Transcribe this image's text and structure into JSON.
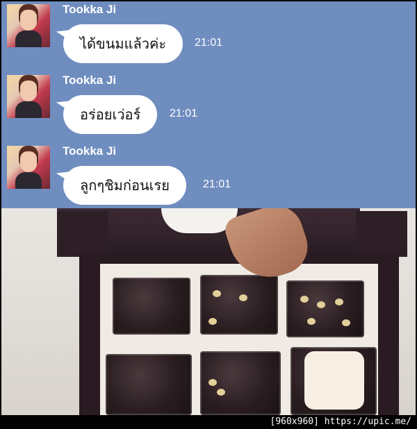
{
  "chat": {
    "messages": [
      {
        "sender": "Tookka Ji",
        "text": "ได้ขนมแล้วค่ะ",
        "time": "21:01"
      },
      {
        "sender": "Tookka Ji",
        "text": "อร่อยเว่อร์",
        "time": "21:01"
      },
      {
        "sender": "Tookka Ji",
        "text": "ลูกๆชิมก่อนเรย",
        "time": "21:01"
      }
    ]
  },
  "colors": {
    "chat_background": "#6f8dbf",
    "bubble": "#ffffff",
    "text_on_chat": "#ffffff"
  },
  "footer": {
    "watermark": "[960x960] https://upic.me/"
  }
}
